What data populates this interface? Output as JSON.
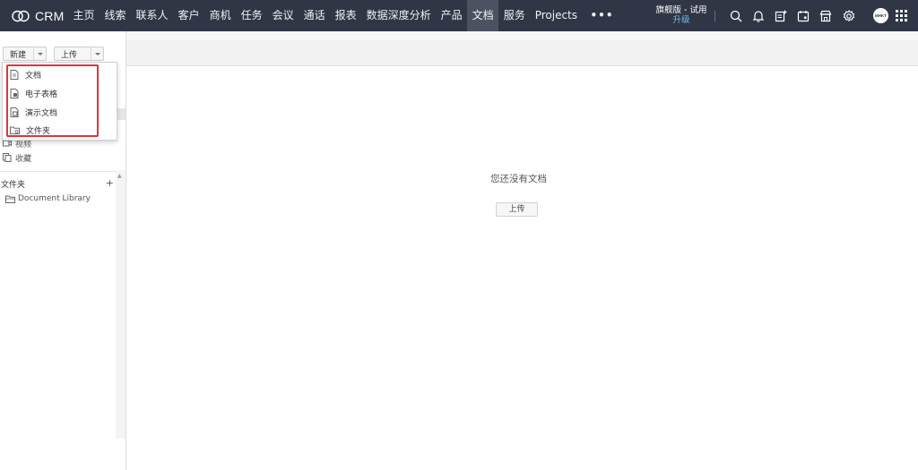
{
  "brand": {
    "name": "CRM"
  },
  "nav": [
    {
      "label": "主页"
    },
    {
      "label": "线索"
    },
    {
      "label": "联系人"
    },
    {
      "label": "客户"
    },
    {
      "label": "商机"
    },
    {
      "label": "任务"
    },
    {
      "label": "会议"
    },
    {
      "label": "通话"
    },
    {
      "label": "报表"
    },
    {
      "label": "数据深度分析"
    },
    {
      "label": "产品"
    },
    {
      "label": "文档"
    },
    {
      "label": "服务"
    },
    {
      "label": "Projects"
    },
    {
      "label": "•••"
    }
  ],
  "active_nav": "文档",
  "edition": {
    "plan": "旗舰版 - 试用",
    "upgrade": "升级"
  },
  "toolbar_icons": [
    "search-icon",
    "bell-icon",
    "add-note-icon",
    "calendar-icon",
    "store-icon",
    "gear-icon"
  ],
  "avatar_text": "MHKT",
  "sidebar": {
    "new_button": "新建",
    "upload_button": "上传",
    "items": [
      {
        "label": "视频",
        "icon": "video-icon"
      },
      {
        "label": "收藏",
        "icon": "favorites-icon"
      }
    ],
    "folders_heading": "文件夹",
    "add_folder": "+",
    "library": "Document Library"
  },
  "new_menu": {
    "items": [
      {
        "label": "文档",
        "icon": "document-icon"
      },
      {
        "label": "电子表格",
        "icon": "spreadsheet-icon"
      },
      {
        "label": "演示文档",
        "icon": "presentation-icon"
      },
      {
        "label": "文件夹",
        "icon": "folder-icon"
      }
    ]
  },
  "main": {
    "empty_message": "您还没有文档",
    "upload_button": "上传"
  },
  "colors": {
    "topbar": "#313646",
    "active_tab": "#4c5261",
    "upgrade_link": "#6fbdf2",
    "highlight_box": "#e0353b"
  }
}
